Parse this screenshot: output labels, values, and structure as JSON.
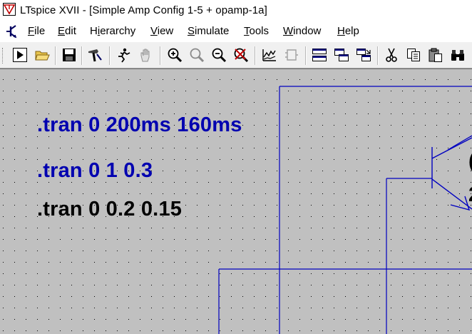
{
  "window": {
    "title": "LTspice XVII - [Simple Amp Config 1-5 + opamp-1a]",
    "app_icon": "ltspice-logo-icon"
  },
  "menu": {
    "icon": "schematic-component-icon",
    "items": [
      "File",
      "Edit",
      "Hierarchy",
      "View",
      "Simulate",
      "Tools",
      "Window",
      "Help"
    ],
    "mnemonics": [
      "F",
      "E",
      "i",
      "V",
      "S",
      "T",
      "W",
      "H"
    ]
  },
  "toolbar": {
    "buttons": [
      "run-icon",
      "open-icon",
      "save-icon",
      "control-panel-icon",
      "halt-icon",
      "pan-icon",
      "zoom-in-icon",
      "zoom-full-icon",
      "zoom-out-icon",
      "zoom-cancel-icon",
      "plot-settings-icon",
      "create-symbol-icon",
      "tile-horizontal-icon",
      "cascade-icon",
      "tile-vertical-icon",
      "cut-icon",
      "copy-icon",
      "paste-icon",
      "find-icon"
    ]
  },
  "schematic": {
    "colors": {
      "background": "#c0c0c0",
      "grid_dot": "#000000",
      "wire": "#0000c0",
      "directive_active": "#0000b0",
      "directive_comment": "#000000"
    },
    "directives": [
      {
        "text": ".tran 0 200ms 160ms",
        "color": "#0000b0"
      },
      {
        "text": ".tran 0 1 0.3",
        "color": "#0000b0"
      },
      {
        "text": ".tran 0 0.2 0.15",
        "color": "#000000"
      }
    ],
    "partial_labels": [
      "(",
      "2"
    ]
  }
}
